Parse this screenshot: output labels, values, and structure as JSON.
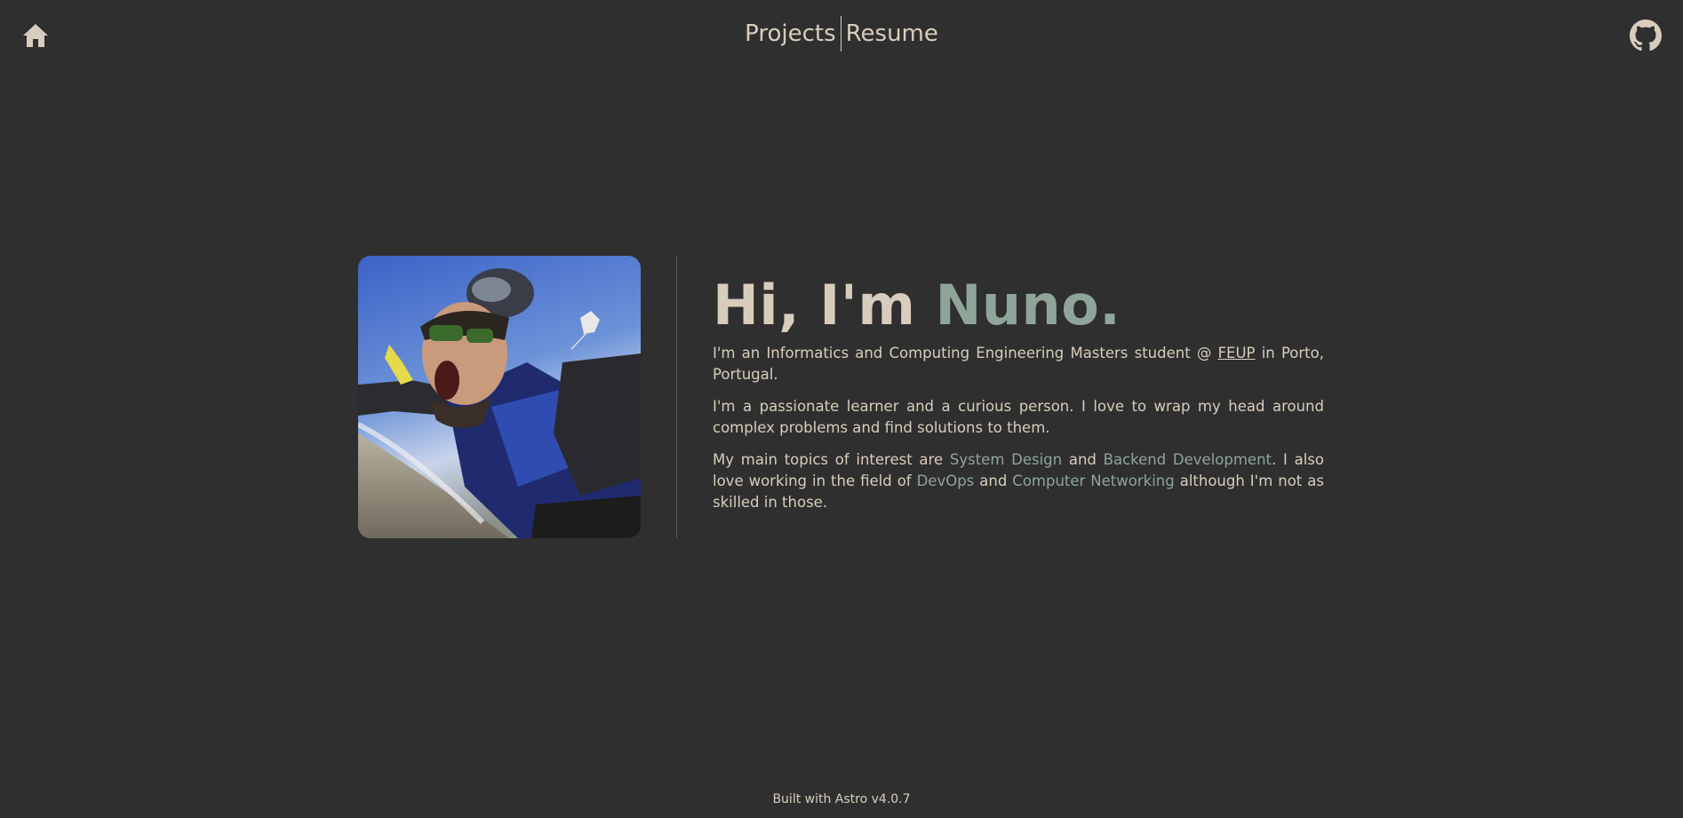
{
  "header": {
    "home_icon": "home-icon",
    "github_icon": "github-icon",
    "nav": [
      {
        "label": "Projects"
      },
      {
        "label": "Resume"
      }
    ]
  },
  "hero": {
    "photo_alt": "skydiving-selfie",
    "greeting_prefix": "Hi, I'm ",
    "greeting_name": "Nuno.",
    "p1": {
      "before": "I'm an Informatics and Computing Engineering Masters student @ ",
      "link": "FEUP",
      "after": " in Porto, Portugal."
    },
    "p2": "I'm a passionate learner and a curious person. I love to wrap my head around complex problems and find solutions to them.",
    "p3": {
      "t1": "My main topics of interest are ",
      "h1": "System Design",
      "t2": " and ",
      "h2": "Backend Development",
      "t3": ". I also love working in the field of ",
      "h3": "DevOps",
      "t4": " and ",
      "h4": "Computer Networking",
      "t5": " although I'm not as skilled in those."
    }
  },
  "footer": {
    "text": "Built with Astro v4.0.7"
  },
  "colors": {
    "background": "#2f2f2f",
    "text": "#d8cdbd",
    "accent": "#8fa59a"
  }
}
